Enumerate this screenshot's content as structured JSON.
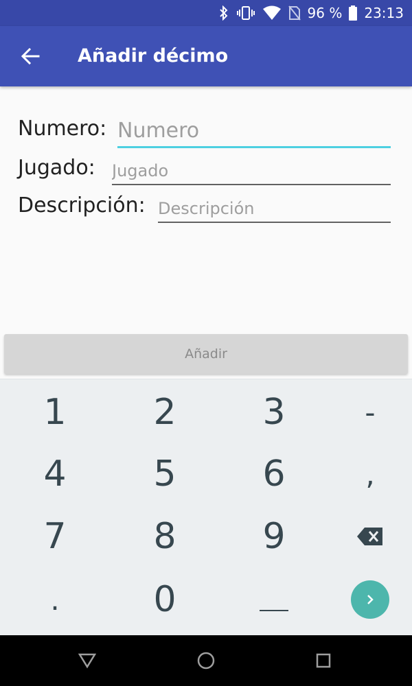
{
  "status_bar": {
    "battery_percent": "96 %",
    "time": "23:13",
    "icons": [
      "bluetooth-icon",
      "vibrate-icon",
      "wifi-icon",
      "no-sim-icon",
      "battery-icon"
    ]
  },
  "app_bar": {
    "title": "Añadir décimo",
    "back_icon": "arrow-back-icon"
  },
  "form": {
    "numero": {
      "label": "Numero:",
      "placeholder": "Numero",
      "value": ""
    },
    "jugado": {
      "label": "Jugado:",
      "placeholder": "Jugado",
      "value": ""
    },
    "descripcion": {
      "label": "Descripción:",
      "placeholder": "Descripción",
      "value": ""
    }
  },
  "add_button": {
    "label": "Añadir"
  },
  "keypad": {
    "keys": [
      "1",
      "2",
      "3",
      "-",
      "4",
      "5",
      "6",
      ",",
      "7",
      "8",
      "9",
      "backspace",
      ".",
      "0",
      "__",
      "go"
    ]
  },
  "colors": {
    "status_bar": "#3848a8",
    "app_bar": "#3f51b5",
    "focus_accent": "#4dd0e1",
    "go_button": "#4db6ac"
  }
}
